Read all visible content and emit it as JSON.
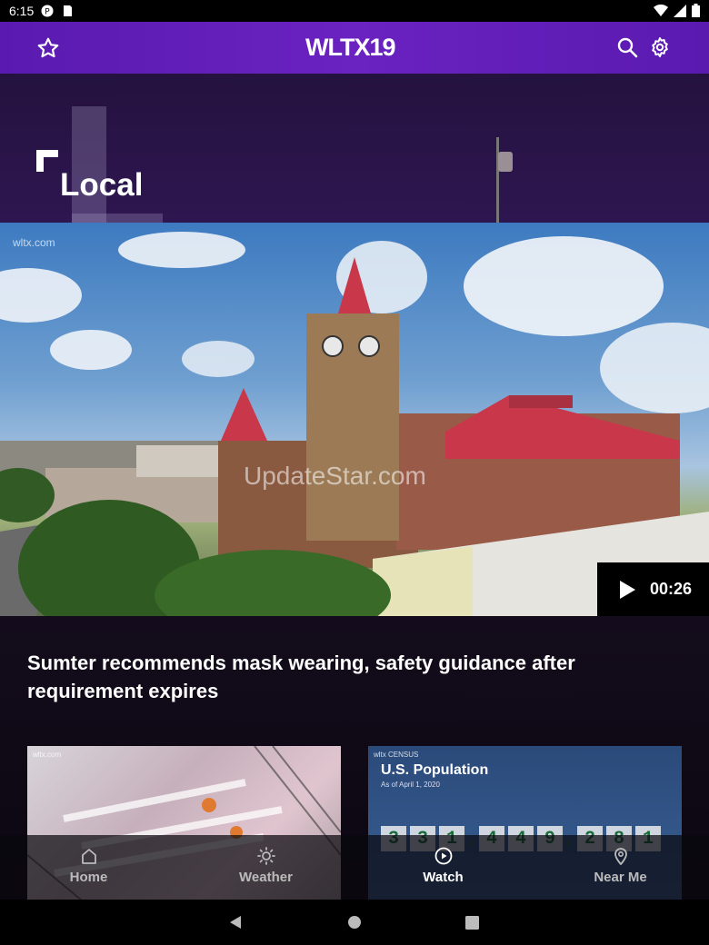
{
  "status_bar": {
    "time": "6:15"
  },
  "app_bar": {
    "logo": "WLTX19"
  },
  "section": {
    "title": "Local"
  },
  "hero": {
    "station_watermark": "wltx.com",
    "site_watermark": "UpdateStar.com",
    "duration": "00:26"
  },
  "headline": "Sumter recommends mask wearing, safety guidance after requirement expires",
  "thumbnails": [
    {
      "tag": "wltx.com"
    },
    {
      "tag": "wltx CENSUS",
      "title": "U.S. Population",
      "subtitle": "As of April 1, 2020",
      "digits": [
        "3",
        "3",
        "1",
        ",",
        "4",
        "4",
        "9",
        ",",
        "2",
        "8",
        "1"
      ]
    }
  ],
  "bottom_nav": {
    "items": [
      {
        "label": "Home",
        "icon": "home-icon"
      },
      {
        "label": "Weather",
        "icon": "sun-icon"
      },
      {
        "label": "Watch",
        "icon": "play-circle-icon",
        "active": true
      },
      {
        "label": "Near Me",
        "icon": "location-pin-icon"
      }
    ]
  },
  "colors": {
    "app_bar": "#6a22c0",
    "header_bg": "#2e1650"
  }
}
